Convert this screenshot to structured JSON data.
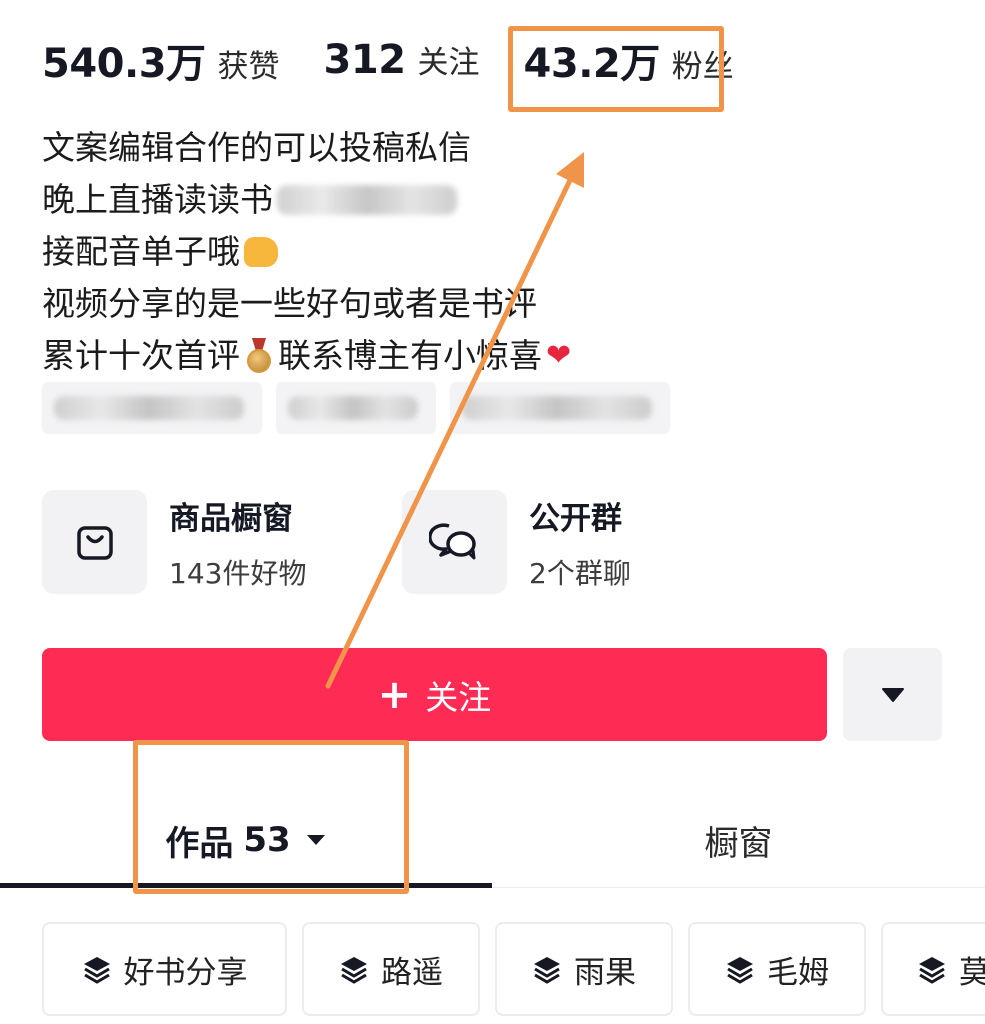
{
  "stats": {
    "likes": {
      "value": "540.3万",
      "label": "获赞"
    },
    "following": {
      "value": "312",
      "label": "关注"
    },
    "followers": {
      "value": "43.2万",
      "label": "粉丝"
    }
  },
  "bio": {
    "line1": "文案编辑合作的可以投稿私信",
    "line2": "晚上直播读读书",
    "line3": "接配音单子哦",
    "line4": "视频分享的是一些好句或者是书评",
    "line5a": "累计十次首评",
    "line5b": "联系博主有小惊喜"
  },
  "services": {
    "shop": {
      "title": "商品橱窗",
      "subtitle": "143件好物",
      "icon": "shopping-bag-icon"
    },
    "group": {
      "title": "公开群",
      "subtitle": "2个群聊",
      "icon": "chat-bubbles-icon"
    }
  },
  "actions": {
    "follow_label": "关注",
    "follow_icon": "plus-icon",
    "more_icon": "caret-down-icon"
  },
  "tabs": {
    "works": {
      "label": "作品",
      "count": "53"
    },
    "shop": {
      "label": "橱窗"
    }
  },
  "collections": [
    "好书分享",
    "路遥",
    "雨果",
    "毛姆",
    "莫"
  ],
  "colors": {
    "accent": "#fe2c55",
    "highlight": "#f0944a"
  }
}
